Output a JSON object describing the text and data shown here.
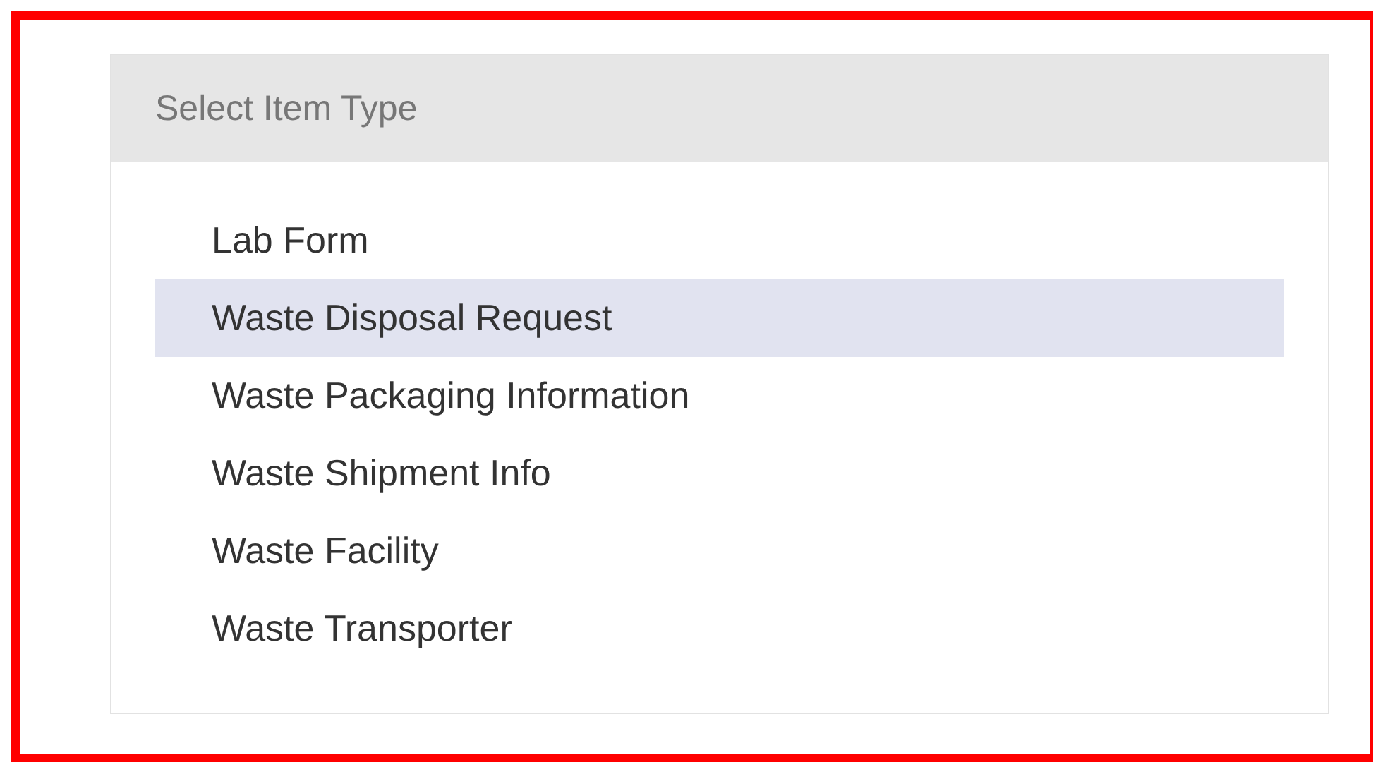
{
  "panel": {
    "title": "Select Item Type"
  },
  "items": [
    {
      "label": "Lab Form",
      "selected": false
    },
    {
      "label": "Waste Disposal Request",
      "selected": true
    },
    {
      "label": "Waste Packaging Information",
      "selected": false
    },
    {
      "label": "Waste Shipment Info",
      "selected": false
    },
    {
      "label": "Waste Facility",
      "selected": false
    },
    {
      "label": "Waste Transporter",
      "selected": false
    }
  ]
}
